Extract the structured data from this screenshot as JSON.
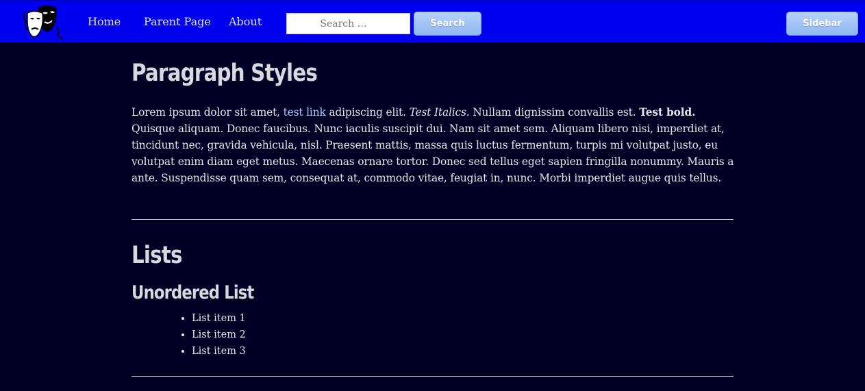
{
  "header": {
    "logo_icon": "theater-masks-icon",
    "nav": [
      {
        "label": "Home"
      },
      {
        "label": "Parent Page"
      },
      {
        "label": "About"
      }
    ],
    "search": {
      "placeholder": "Search …",
      "button_label": "Search"
    },
    "sidebar_button_label": "Sidebar",
    "colors": {
      "bar": "#0000ee",
      "button": "#9fc3f7",
      "page_background": "#000025"
    }
  },
  "content": {
    "paragraph_section": {
      "heading": "Paragraph Styles",
      "text_1": "Lorem ipsum dolor sit amet, ",
      "link_text": "test link",
      "text_2": " adipiscing elit. ",
      "italic_text": "Test Italics.",
      "text_3": " Nullam dignissim convallis est. ",
      "bold_text": "Test bold.",
      "text_4": " Quisque aliquam. Donec faucibus. Nunc iaculis suscipit dui. Nam sit amet sem. Aliquam libero nisi, imperdiet at, tincidunt nec, gravida vehicula, nisl. Praesent mattis, massa quis luctus fermentum, turpis mi volutpat justo, eu volutpat enim diam eget metus. Maecenas ornare tortor. Donec sed tellus eget sapien fringilla nonummy. Mauris a ante. Suspendisse quam sem, consequat at, commodo vitae, feugiat in, nunc. Morbi imperdiet augue quis tellus."
    },
    "lists_section": {
      "heading": "Lists",
      "unordered_heading": "Unordered List",
      "unordered_items": [
        "List item 1",
        "List item 2",
        "List item 3"
      ]
    }
  }
}
